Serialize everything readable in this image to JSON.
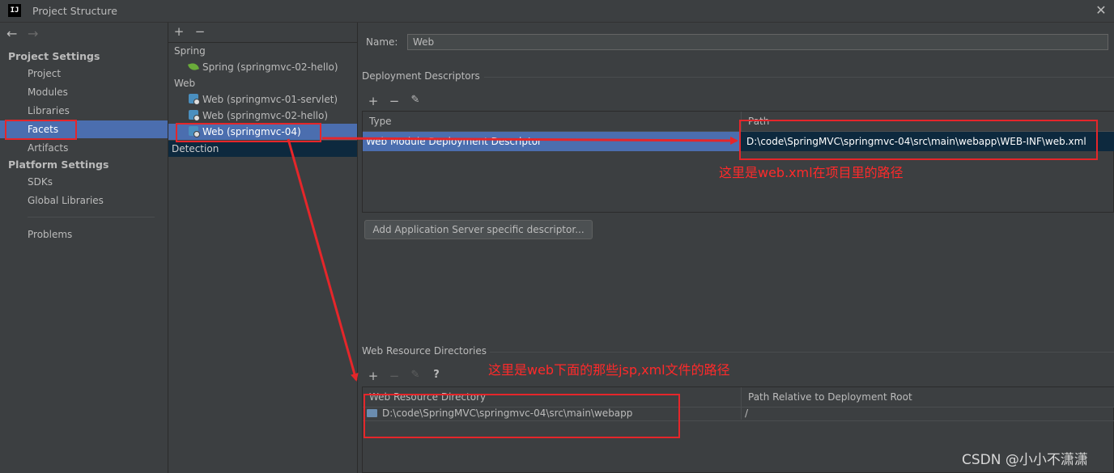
{
  "window": {
    "title": "Project Structure",
    "app_icon_text": "IJ"
  },
  "colors": {
    "selection": "#4b6eaf",
    "annotation": "#e5262a",
    "background": "#3c3f41"
  },
  "sidebar": {
    "back_label": "←",
    "forward_label": "→",
    "project_settings": {
      "heading": "Project Settings",
      "items": [
        "Project",
        "Modules",
        "Libraries",
        "Facets",
        "Artifacts"
      ]
    },
    "platform_settings": {
      "heading": "Platform Settings",
      "items": [
        "SDKs",
        "Global Libraries"
      ]
    },
    "problems": "Problems",
    "selected": "Facets"
  },
  "facets": {
    "add_label": "+",
    "remove_label": "−",
    "groups": [
      {
        "label": "Spring",
        "children": [
          "Spring (springmvc-02-hello)"
        ]
      },
      {
        "label": "Web",
        "children": [
          "Web (springmvc-01-servlet)",
          "Web (springmvc-02-hello)",
          "Web (springmvc-04)"
        ]
      }
    ],
    "detection": "Detection",
    "selected": "Web (springmvc-04)"
  },
  "detail": {
    "name_label": "Name:",
    "name_value": "Web",
    "deployment": {
      "title": "Deployment Descriptors",
      "columns": [
        "Type",
        "Path"
      ],
      "rows": [
        {
          "type": "Web Module Deployment Descriptor",
          "path": "D:\\code\\SpringMVC\\springmvc-04\\src\\main\\webapp\\WEB-INF\\web.xml"
        }
      ],
      "add_server_button": "Add Application Server specific descriptor..."
    },
    "resources": {
      "title": "Web Resource Directories",
      "help_label": "?",
      "columns": [
        "Web Resource Directory",
        "Path Relative to Deployment Root"
      ],
      "rows": [
        {
          "directory": "D:\\code\\SpringMVC\\springmvc-04\\src\\main\\webapp",
          "relative": "/"
        }
      ]
    }
  },
  "annotations": {
    "webxml_note": "这里是web.xml在项目里的路径",
    "resources_note": "这里是web下面的那些jsp,xml文件的路径"
  },
  "watermark": "CSDN @小小不潇潇"
}
